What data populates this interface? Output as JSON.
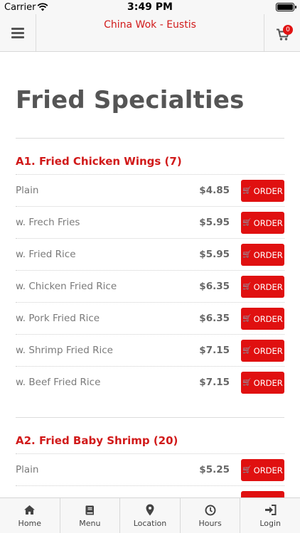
{
  "status_bar": {
    "carrier": "Carrier",
    "time": "3:49 PM"
  },
  "header": {
    "title": "China Wok - Eustis",
    "cart_count": "0",
    "accent_color": "#d11a1a"
  },
  "page": {
    "title": "Fried Specialties"
  },
  "sections": [
    {
      "title": "A1. Fried Chicken Wings (7)",
      "items": [
        {
          "name": "Plain",
          "price": "$4.85",
          "button": "ORDER"
        },
        {
          "name": "w. Frech Fries",
          "price": "$5.95",
          "button": "ORDER"
        },
        {
          "name": "w. Fried Rice",
          "price": "$5.95",
          "button": "ORDER"
        },
        {
          "name": "w. Chicken Fried Rice",
          "price": "$6.35",
          "button": "ORDER"
        },
        {
          "name": "w. Pork Fried Rice",
          "price": "$6.35",
          "button": "ORDER"
        },
        {
          "name": "w. Shrimp Fried Rice",
          "price": "$7.15",
          "button": "ORDER"
        },
        {
          "name": "w. Beef Fried Rice",
          "price": "$7.15",
          "button": "ORDER"
        }
      ]
    },
    {
      "title": "A2. Fried Baby Shrimp (20)",
      "items": [
        {
          "name": "Plain",
          "price": "$5.25",
          "button": "ORDER"
        }
      ]
    }
  ],
  "tabs": [
    {
      "label": "Home",
      "icon": "home-icon"
    },
    {
      "label": "Menu",
      "icon": "book-icon"
    },
    {
      "label": "Location",
      "icon": "map-marker-icon"
    },
    {
      "label": "Hours",
      "icon": "clock-icon"
    },
    {
      "label": "Login",
      "icon": "login-icon"
    }
  ]
}
